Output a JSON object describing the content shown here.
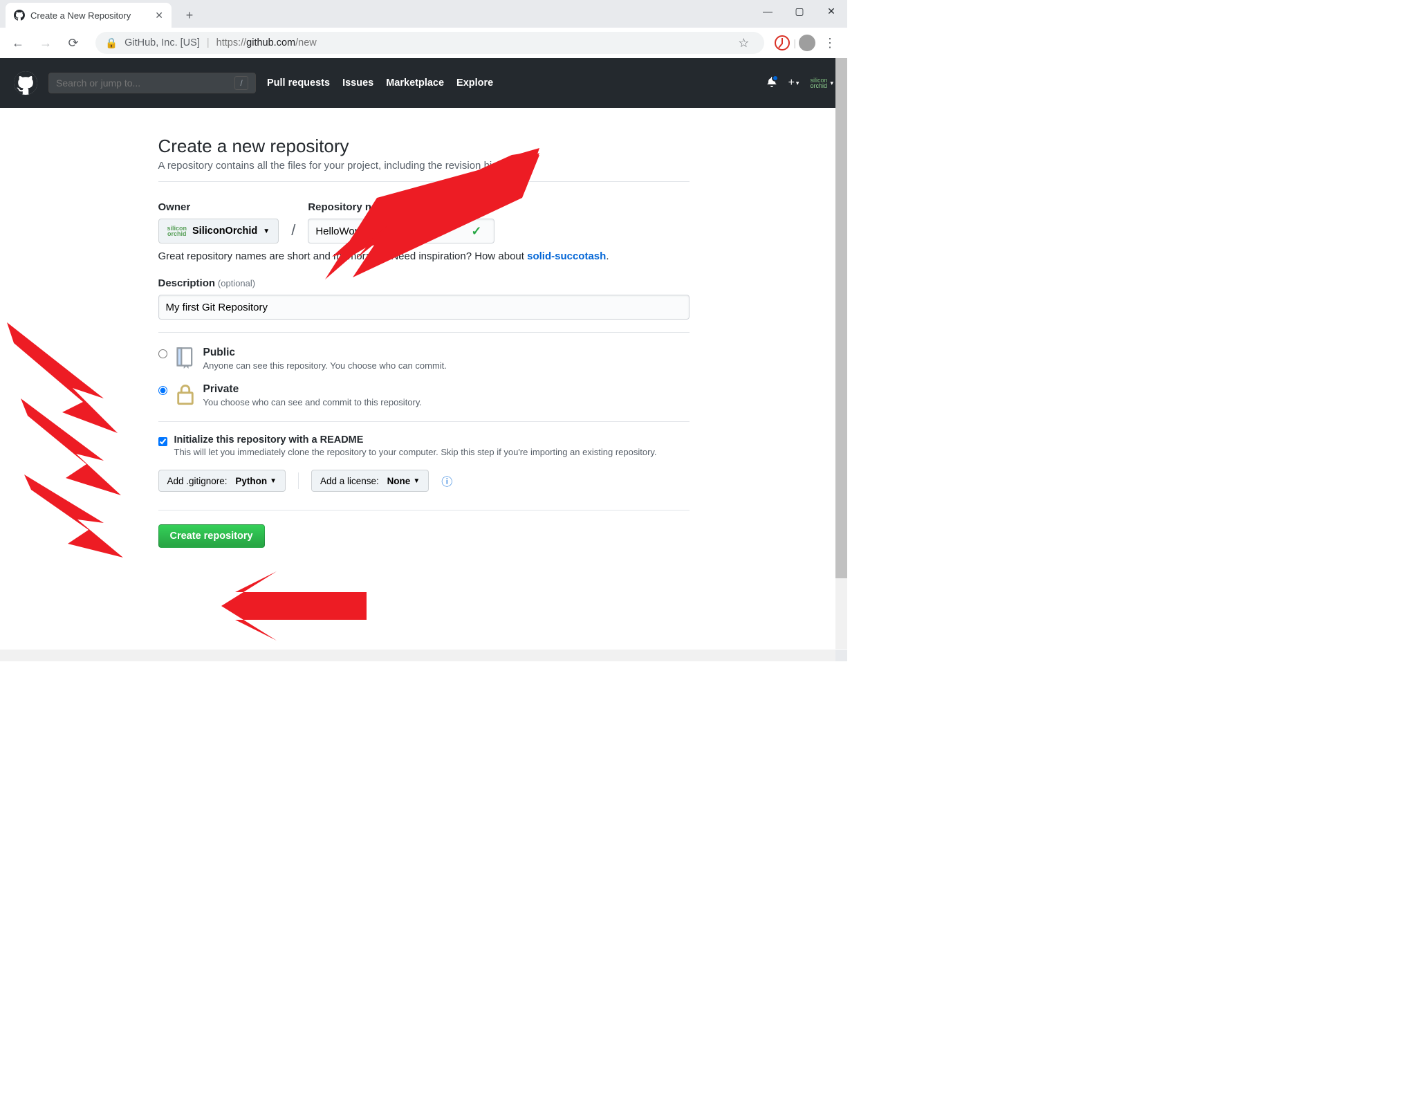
{
  "window": {
    "tab_title": "Create a New Repository",
    "min": "—",
    "max": "▢",
    "close": "✕",
    "new_tab": "+"
  },
  "toolbar": {
    "back": "←",
    "forward": "→",
    "reload": "⟳",
    "secure_org": "GitHub, Inc. [US]",
    "url_prefix": "https://",
    "url_domain": "github.com",
    "url_path": "/new",
    "star": "☆",
    "menu": "⋮"
  },
  "gh_header": {
    "search_placeholder": "Search or jump to...",
    "slash": "/",
    "nav": [
      "Pull requests",
      "Issues",
      "Marketplace",
      "Explore"
    ],
    "plus": "+",
    "caret": "▾",
    "user_logo_line1": "silicon",
    "user_logo_line2": "orchid"
  },
  "page": {
    "title": "Create a new repository",
    "subtitle": "A repository contains all the files for your project, including the revision history.",
    "owner_label": "Owner",
    "repo_label": "Repository name",
    "owner_value": "SiliconOrchid",
    "repo_value": "HelloWorld",
    "slash": "/",
    "hint_prefix": "Great repository names are short and memorable. Need inspiration? How about ",
    "hint_suggestion": "solid-succotash",
    "hint_suffix": ".",
    "desc_label": "Description",
    "desc_optional": "(optional)",
    "desc_value": "My first Git Repository",
    "public_title": "Public",
    "public_desc": "Anyone can see this repository. You choose who can commit.",
    "private_title": "Private",
    "private_desc": "You choose who can see and commit to this repository.",
    "readme_title": "Initialize this repository with a README",
    "readme_desc": "This will let you immediately clone the repository to your computer. Skip this step if you're importing an existing repository.",
    "gitignore_prefix": "Add .gitignore:",
    "gitignore_value": "Python",
    "license_prefix": "Add a license:",
    "license_value": "None",
    "submit_label": "Create repository"
  }
}
